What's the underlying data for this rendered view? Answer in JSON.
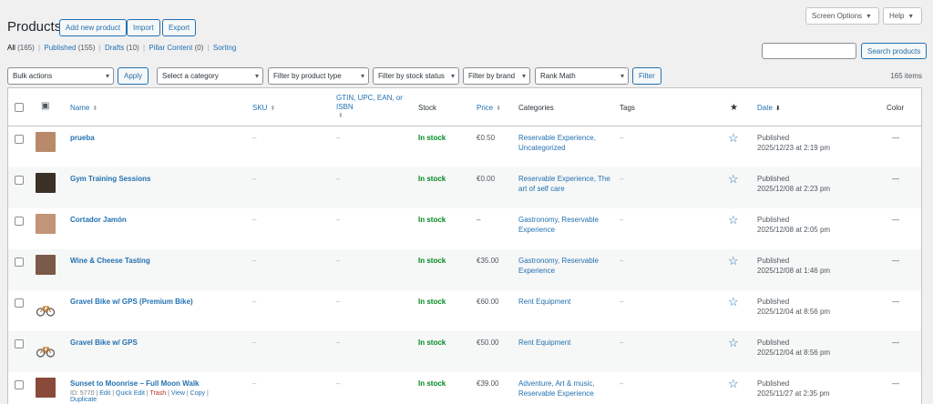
{
  "header": {
    "title": "Products",
    "add_new": "Add new product",
    "import": "Import",
    "export": "Export",
    "screen_options": "Screen Options",
    "help": "Help"
  },
  "views": {
    "all_label": "All",
    "all_count": "(165)",
    "published_label": "Published",
    "published_count": "(155)",
    "drafts_label": "Drafts",
    "drafts_count": "(10)",
    "pillar_label": "Pillar Content",
    "pillar_count": "(0)",
    "sorting_label": "Sorting",
    "separator": "|"
  },
  "search": {
    "button": "Search products",
    "value": ""
  },
  "filters": {
    "bulk_actions": "Bulk actions",
    "apply": "Apply",
    "category": "Select a category",
    "product_type": "Filter by product type",
    "stock_status": "Filter by stock status",
    "brand": "Filter by brand",
    "rank_math": "Rank Math",
    "filter_button": "Filter"
  },
  "items_count": "165 items",
  "icons": {
    "caret": "▾",
    "image_col": "▣",
    "featured_col": "★",
    "featured_empty": "☆",
    "sort": "⬍",
    "sort_desc": "⬇"
  },
  "columns": {
    "name": "Name",
    "sku": "SKU",
    "gtin_1": "GTIN, UPC, EAN, or",
    "gtin_2": "ISBN",
    "stock": "Stock",
    "price": "Price",
    "categories": "Categories",
    "tags": "Tags",
    "date": "Date",
    "color": "Color"
  },
  "rows": [
    {
      "name": "prueba",
      "sku": "–",
      "gtin": "–",
      "stock": "In stock",
      "price": "€0.50",
      "cat1": "Reservable Experience,",
      "cat2": "Uncategorized",
      "tags": "–",
      "status": "Published",
      "date": "2025/12/23 at 2:19 pm",
      "color": "—",
      "thumb": "#b98a6a"
    },
    {
      "name": "Gym Training Sessions",
      "sku": "–",
      "gtin": "–",
      "stock": "In stock",
      "price": "€0.00",
      "cat1": "Reservable Experience, The",
      "cat2": "art of self care",
      "tags": "–",
      "status": "Published",
      "date": "2025/12/08 at 2:23 pm",
      "color": "—",
      "thumb": "#3a3026"
    },
    {
      "name": "Cortador Jamón",
      "sku": "–",
      "gtin": "–",
      "stock": "In stock",
      "price": "–",
      "cat1": "Gastronomy, Reservable",
      "cat2": "Experience",
      "tags": "–",
      "status": "Published",
      "date": "2025/12/08 at 2:05 pm",
      "color": "—",
      "thumb": "#c29478"
    },
    {
      "name": "Wine & Cheese Tasting",
      "sku": "–",
      "gtin": "–",
      "stock": "In stock",
      "price": "€35.00",
      "cat1": "Gastronomy, Reservable",
      "cat2": "Experience",
      "tags": "–",
      "status": "Published",
      "date": "2025/12/08 at 1:46 pm",
      "color": "—",
      "thumb": "#7a5a48"
    },
    {
      "name": "Gravel Bike w/ GPS (Premium Bike)",
      "sku": "–",
      "gtin": "–",
      "stock": "In stock",
      "price": "€60.00",
      "cat1": "Rent Equipment",
      "cat2": "",
      "tags": "–",
      "status": "Published",
      "date": "2025/12/04 at 8:56 pm",
      "color": "—",
      "thumb": "bike"
    },
    {
      "name": "Gravel Bike w/ GPS",
      "sku": "–",
      "gtin": "–",
      "stock": "In stock",
      "price": "€50.00",
      "cat1": "Rent Equipment",
      "cat2": "",
      "tags": "–",
      "status": "Published",
      "date": "2025/12/04 at 8:56 pm",
      "color": "—",
      "thumb": "bike"
    },
    {
      "name": "Sunset to Moonrise – Full Moon Walk",
      "sku": "–",
      "gtin": "–",
      "stock": "In stock",
      "price": "€39.00",
      "cat1": "Adventure, Art & music,",
      "cat2": "Reservable Experience",
      "tags": "–",
      "status": "Published",
      "date": "2025/11/27 at 2:35 pm",
      "color": "—",
      "thumb": "#8a4a3a"
    }
  ],
  "row_actions": {
    "id": "ID: 5770",
    "edit": "Edit",
    "quick_edit": "Quick Edit",
    "trash": "Trash",
    "view": "View",
    "copy": "Copy",
    "duplicate": "Duplicate",
    "sep": "|"
  }
}
